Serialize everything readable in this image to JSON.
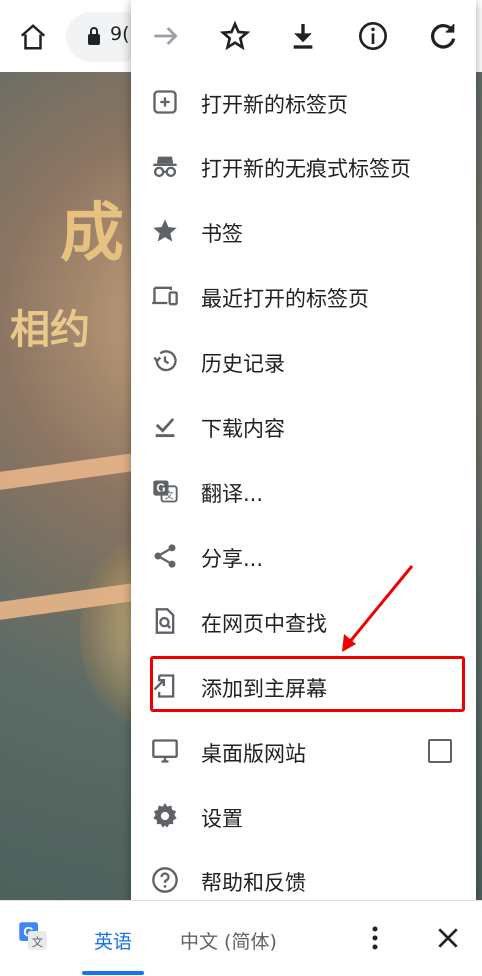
{
  "toolbar": {
    "url_partial": "9("
  },
  "menu": {
    "items": [
      {
        "label": "打开新的标签页"
      },
      {
        "label": "打开新的无痕式标签页"
      },
      {
        "label": "书签"
      },
      {
        "label": "最近打开的标签页"
      },
      {
        "label": "历史记录"
      },
      {
        "label": "下载内容"
      },
      {
        "label": "翻译..."
      },
      {
        "label": "分享..."
      },
      {
        "label": "在网页中查找"
      },
      {
        "label": "添加到主屏幕"
      },
      {
        "label": "桌面版网站"
      },
      {
        "label": "设置"
      },
      {
        "label": "帮助和反馈"
      }
    ],
    "desktop_site_checked": false
  },
  "translate_bar": {
    "lang_source": "英语",
    "lang_target": "中文 (简体)"
  },
  "page_bg_text": {
    "line1": "成",
    "line2": "相约"
  },
  "colors": {
    "accent": "#1a73e8",
    "annotation": "#e00000"
  }
}
